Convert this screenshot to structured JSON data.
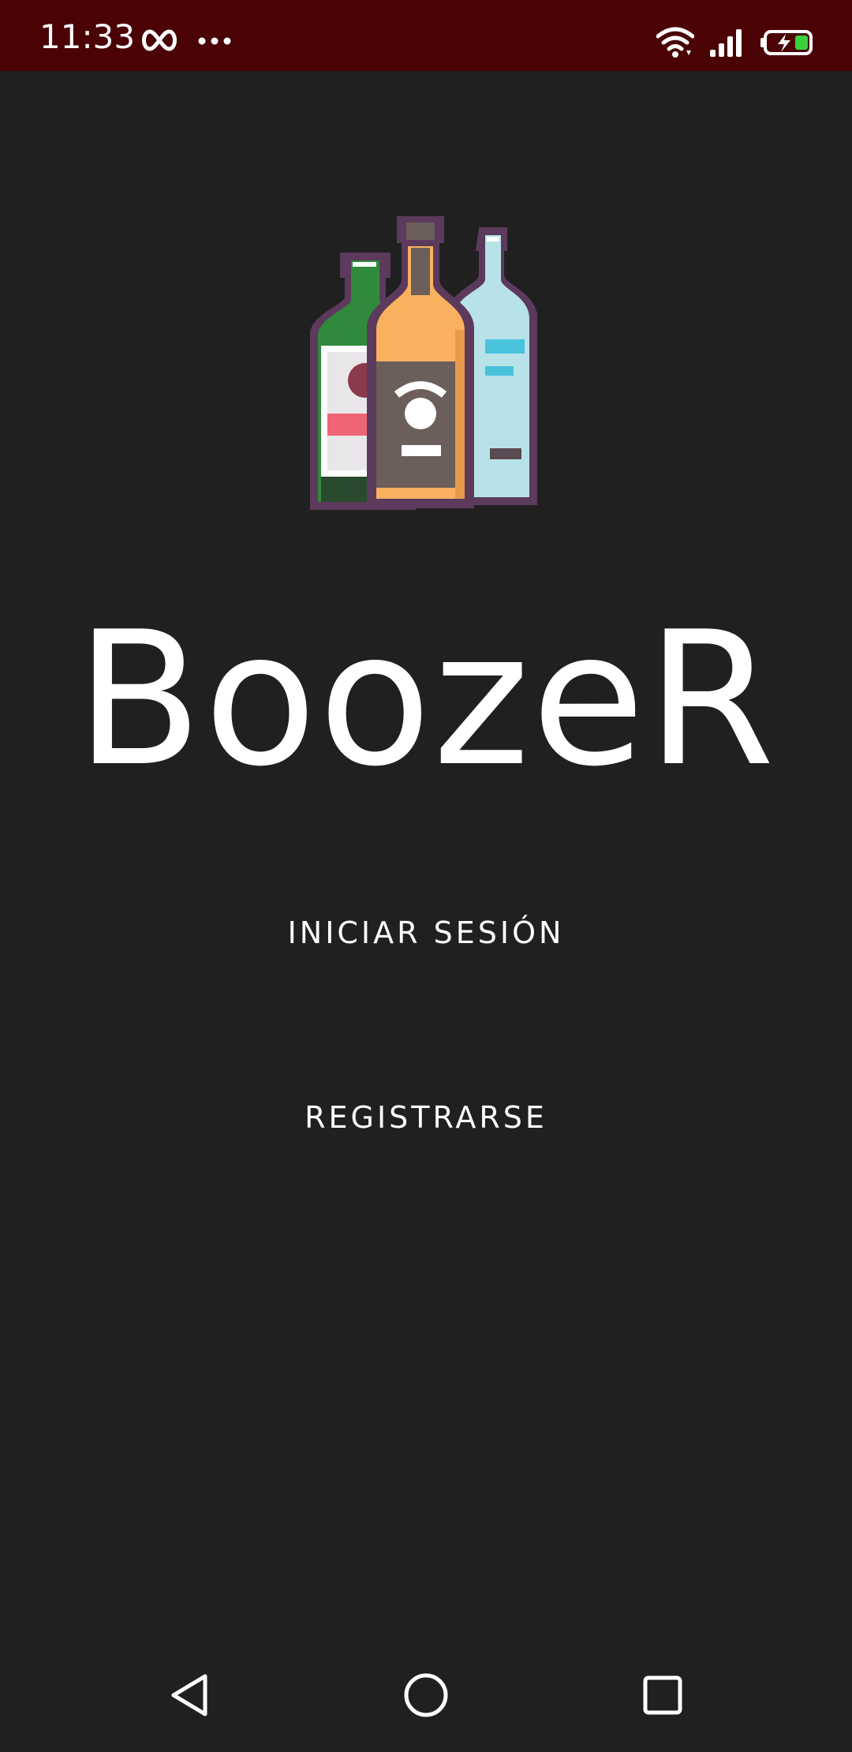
{
  "status_bar": {
    "time": "11:33",
    "left_icons": [
      "infinity-icon",
      "more-dots-icon"
    ],
    "right_icons": [
      "wifi-icon",
      "signal-icon",
      "battery-charging-icon"
    ],
    "background": "#4a0204"
  },
  "app": {
    "title": "BoozeR",
    "logo": "bottles-logo"
  },
  "buttons": {
    "login_label": "INICIAR SESIÓN",
    "register_label": "REGISTRARSE"
  },
  "nav_bar": {
    "icons": [
      "back-icon",
      "home-icon",
      "recents-icon"
    ]
  },
  "colors": {
    "background": "#202020",
    "text": "#ffffff"
  }
}
